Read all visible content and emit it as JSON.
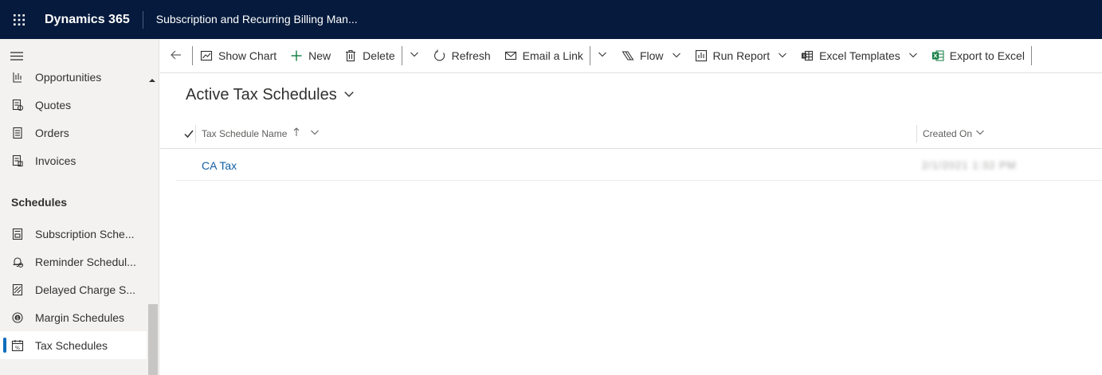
{
  "topbar": {
    "brand": "Dynamics 365",
    "app_title": "Subscription and Recurring Billing Man..."
  },
  "sidebar": {
    "items_top": [
      {
        "label": "Opportunities",
        "icon": "opportunity-icon"
      },
      {
        "label": "Quotes",
        "icon": "quote-icon"
      },
      {
        "label": "Orders",
        "icon": "order-icon"
      },
      {
        "label": "Invoices",
        "icon": "invoice-icon"
      }
    ],
    "group_header": "Schedules",
    "items_schedules": [
      {
        "label": "Subscription Sche...",
        "icon": "subscription-schedule-icon"
      },
      {
        "label": "Reminder Schedul...",
        "icon": "reminder-schedule-icon"
      },
      {
        "label": "Delayed Charge S...",
        "icon": "delayed-charge-icon"
      },
      {
        "label": "Margin Schedules",
        "icon": "margin-schedule-icon"
      },
      {
        "label": "Tax Schedules",
        "icon": "tax-schedule-icon",
        "active": true
      }
    ]
  },
  "commandbar": {
    "show_chart": "Show Chart",
    "new": "New",
    "delete": "Delete",
    "refresh": "Refresh",
    "email_link": "Email a Link",
    "flow": "Flow",
    "run_report": "Run Report",
    "excel_templates": "Excel Templates",
    "export_excel": "Export to Excel"
  },
  "view": {
    "title": "Active Tax Schedules",
    "columns": [
      "Tax Schedule Name",
      "Created On"
    ],
    "rows": [
      {
        "name": "CA Tax",
        "created_on": "2/1/2021 1:32 PM"
      }
    ]
  },
  "colors": {
    "topbar_bg": "#051a3c",
    "accent": "#0f6cbd",
    "link": "#115ea3",
    "excel_green": "#107c41"
  }
}
